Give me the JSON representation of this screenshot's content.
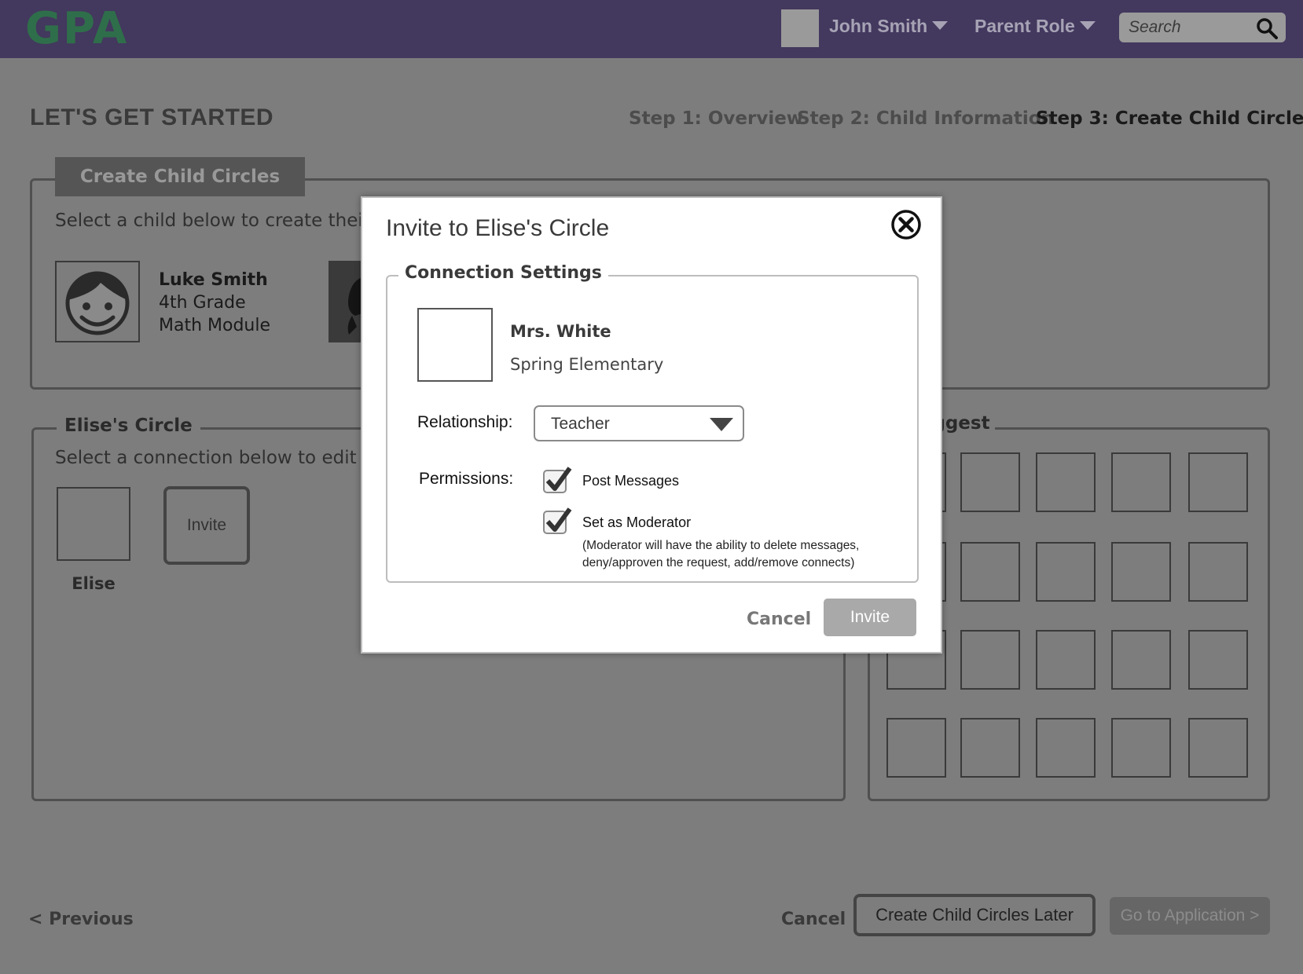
{
  "header": {
    "logo": "GPA",
    "user_name": "John Smith",
    "role": "Parent Role",
    "search_placeholder": "Search"
  },
  "page": {
    "title": "LET'S GET STARTED",
    "steps": [
      {
        "label": "Step 1: Overview",
        "current": false
      },
      {
        "label": "Step 2: Child Information",
        "current": false
      },
      {
        "label": "Step 3: Create Child Circles",
        "current": true
      }
    ]
  },
  "create_panel": {
    "tab_label": "Create Child Circles",
    "instruction": "Select a child below to create their",
    "child": {
      "name": "Luke Smith",
      "grade": "4th Grade",
      "module": "Math Module"
    }
  },
  "circle_panel": {
    "legend": "Elise's Circle",
    "instruction": "Select a connection below to edit c",
    "member_label": "Elise",
    "invite_tile_label": "Invite"
  },
  "suggest_panel": {
    "legend": "uggest"
  },
  "footer": {
    "previous": "< Previous",
    "cancel": "Cancel",
    "later": "Create Child Circles Later",
    "go_app": "Go to Application >"
  },
  "modal": {
    "title": "Invite to Elise's Circle",
    "section": "Connection Settings",
    "person_name": "Mrs. White",
    "person_school": "Spring Elementary",
    "relationship_label": "Relationship:",
    "relationship_value": "Teacher",
    "permissions_label": "Permissions:",
    "permissions": [
      {
        "label": "Post Messages",
        "checked": true
      },
      {
        "label": "Set as Moderator",
        "checked": true
      }
    ],
    "moderator_note": "(Moderator will have the ability to delete messages, deny/approven the request, add/remove connects)",
    "cancel": "Cancel",
    "invite": "Invite"
  }
}
